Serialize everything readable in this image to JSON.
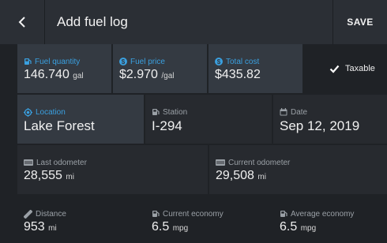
{
  "header": {
    "title": "Add fuel log",
    "save_label": "SAVE"
  },
  "fuel_quantity": {
    "label": "Fuel quantity",
    "value": "146.740",
    "unit": "gal"
  },
  "fuel_price": {
    "label": "Fuel price",
    "value": "$2.970",
    "unit": "/gal"
  },
  "total_cost": {
    "label": "Total cost",
    "value": "$435.82"
  },
  "taxable": {
    "label": "Taxable",
    "checked": true
  },
  "location": {
    "label": "Location",
    "value": "Lake Forest"
  },
  "station": {
    "label": "Station",
    "value": "I-294"
  },
  "date": {
    "label": "Date",
    "value": "Sep 12, 2019"
  },
  "last_odometer": {
    "label": "Last odometer",
    "value": "28,555",
    "unit": "mi"
  },
  "current_odometer": {
    "label": "Current odometer",
    "value": "29,508",
    "unit": "mi"
  },
  "distance": {
    "label": "Distance",
    "value": "953",
    "unit": "mi"
  },
  "current_economy": {
    "label": "Current economy",
    "value": "6.5",
    "unit": "mpg"
  },
  "average_economy": {
    "label": "Average economy",
    "value": "6.5",
    "unit": "mpg"
  },
  "colors": {
    "accent": "#3aa0e0",
    "card_active": "#343a42",
    "card": "#272a2f",
    "background": "#1f2226"
  },
  "icons": [
    "back-arrow-icon",
    "fuel-pump-icon",
    "dollar-icon",
    "location-target-icon",
    "station-pump-icon",
    "calendar-icon",
    "odometer-icon",
    "ruler-icon",
    "checkbox-checked-icon"
  ]
}
